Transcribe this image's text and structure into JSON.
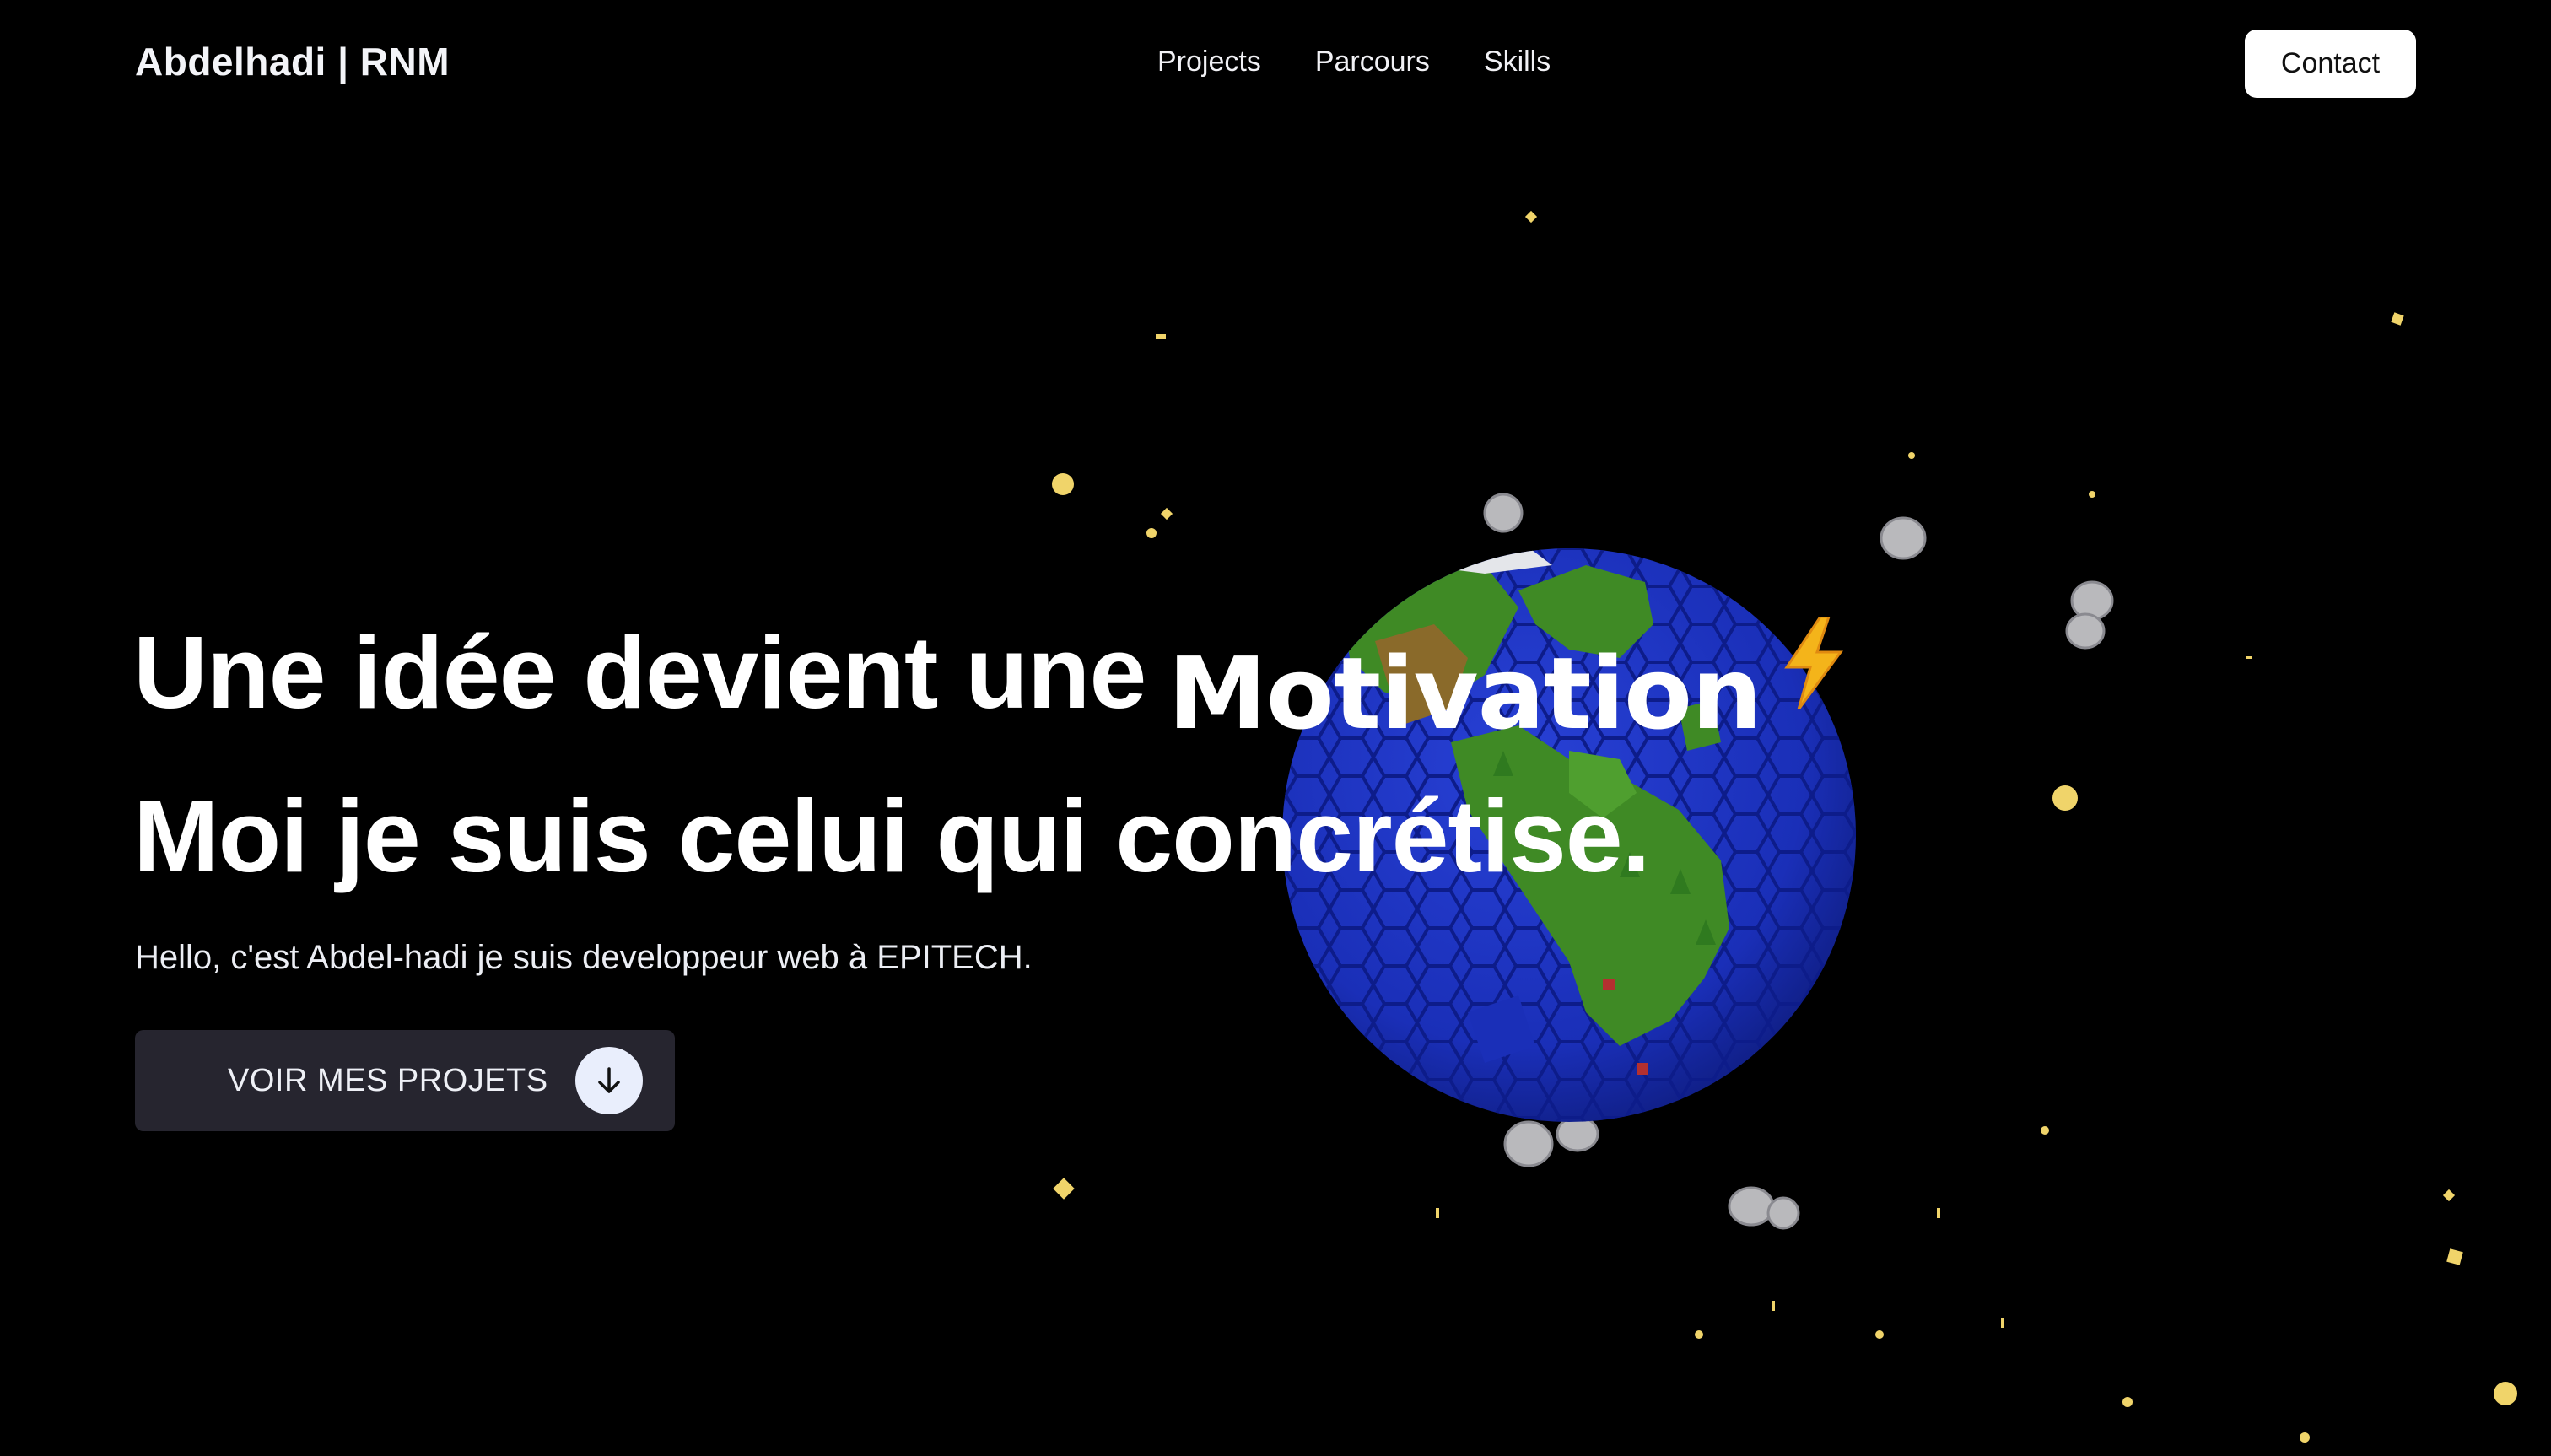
{
  "header": {
    "brand": "Abdelhadi | RNM",
    "nav": [
      "Projects",
      "Parcours",
      "Skills"
    ],
    "contact_label": "Contact"
  },
  "hero": {
    "line1": "Une idée devient une",
    "highlight": "Motivation",
    "line2": "Moi je suis celui qui concrétise.",
    "subtitle": "Hello, c'est Abdel-hadi je suis developpeur web à EPITECH.",
    "cta_label": "VOIR MES PROJETS"
  },
  "icons": {
    "highlight_icon": "lightning-bolt-icon",
    "cta_icon": "arrow-down-icon",
    "scene": "low-poly-planet-illustration"
  },
  "colors": {
    "background": "#000000",
    "cta_background": "#26252f",
    "cta_icon_background": "#e9eefc",
    "ocean": "#1a2fb8",
    "land": "#3f8a25",
    "star": "#f0d46a",
    "bolt": "#f4b41a"
  }
}
